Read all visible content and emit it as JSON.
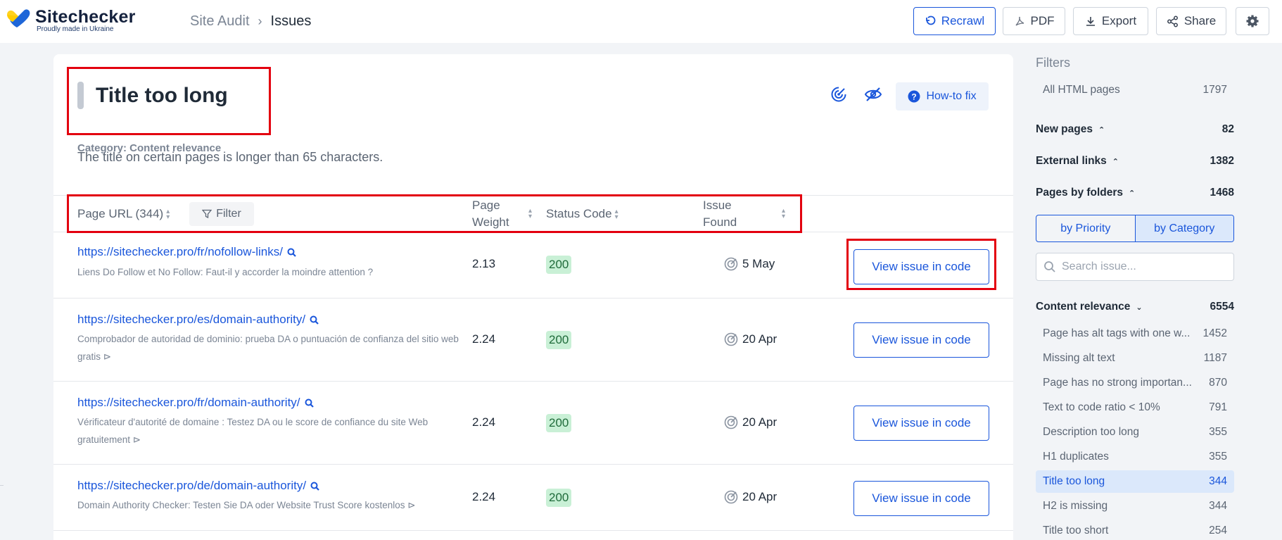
{
  "brand": {
    "name": "Sitechecker",
    "tagline": "Proudly made in Ukraine"
  },
  "breadcrumb": {
    "parent": "Site Audit",
    "separator": "›",
    "current": "Issues"
  },
  "header_buttons": {
    "recrawl": "Recrawl",
    "pdf": "PDF",
    "export": "Export",
    "share": "Share"
  },
  "issue": {
    "title": "Title too long",
    "category": "Category: Content relevance",
    "description": "The title on certain pages is longer than 65 characters.",
    "how_to_fix": "How-to fix"
  },
  "table": {
    "columns": {
      "url": "Page URL (344)",
      "filter": "Filter",
      "weight_line1": "Page",
      "weight_line2": "Weight",
      "status": "Status Code",
      "found_line1": "Issue",
      "found_line2": "Found"
    },
    "rows": [
      {
        "url": "https://sitechecker.pro/fr/nofollow-links/",
        "desc": "Liens Do Follow et No Follow: Faut-il y accorder la moindre attention ?",
        "weight": "2.13",
        "status": "200",
        "found": "5 May",
        "action": "View issue in code"
      },
      {
        "url": "https://sitechecker.pro/es/domain-authority/",
        "desc": "Comprobador de autoridad de dominio: prueba DA o puntuación de confianza del sitio web gratis ⊳",
        "weight": "2.24",
        "status": "200",
        "found": "20 Apr",
        "action": "View issue in code"
      },
      {
        "url": "https://sitechecker.pro/fr/domain-authority/",
        "desc": "Vérificateur d'autorité de domaine : Testez DA ou le score de confiance du site Web gratuitement ⊳",
        "weight": "2.24",
        "status": "200",
        "found": "20 Apr",
        "action": "View issue in code"
      },
      {
        "url": "https://sitechecker.pro/de/domain-authority/",
        "desc": "Domain Authority Checker: Testen Sie DA oder Website Trust Score kostenlos ⊳",
        "weight": "2.24",
        "status": "200",
        "found": "20 Apr",
        "action": "View issue in code"
      }
    ]
  },
  "sidebar": {
    "heading": "Filters",
    "all_html": {
      "label": "All HTML pages",
      "count": "1797"
    },
    "new_pages": {
      "label": "New pages",
      "count": "82"
    },
    "external_links": {
      "label": "External links",
      "count": "1382"
    },
    "pages_by_folders": {
      "label": "Pages by folders",
      "count": "1468"
    },
    "toggle": {
      "priority": "by Priority",
      "category": "by Category"
    },
    "search_placeholder": "Search issue...",
    "content_relevance": {
      "label": "Content relevance",
      "count": "6554"
    },
    "issues": [
      {
        "label": "Page has alt tags with one w...",
        "count": "1452"
      },
      {
        "label": "Missing alt text",
        "count": "1187"
      },
      {
        "label": "Page has no strong importan...",
        "count": "870"
      },
      {
        "label": "Text to code ratio < 10%",
        "count": "791"
      },
      {
        "label": "Description too long",
        "count": "355"
      },
      {
        "label": "H1 duplicates",
        "count": "355"
      },
      {
        "label": "Title too long",
        "count": "344"
      },
      {
        "label": "H2 is missing",
        "count": "344"
      },
      {
        "label": "Title too short",
        "count": "254"
      }
    ]
  },
  "colors": {
    "accent": "#1a56db",
    "highlight": "#e3000f",
    "status_ok_bg": "#c9f0d6",
    "active_bg": "#dbe8fb"
  }
}
